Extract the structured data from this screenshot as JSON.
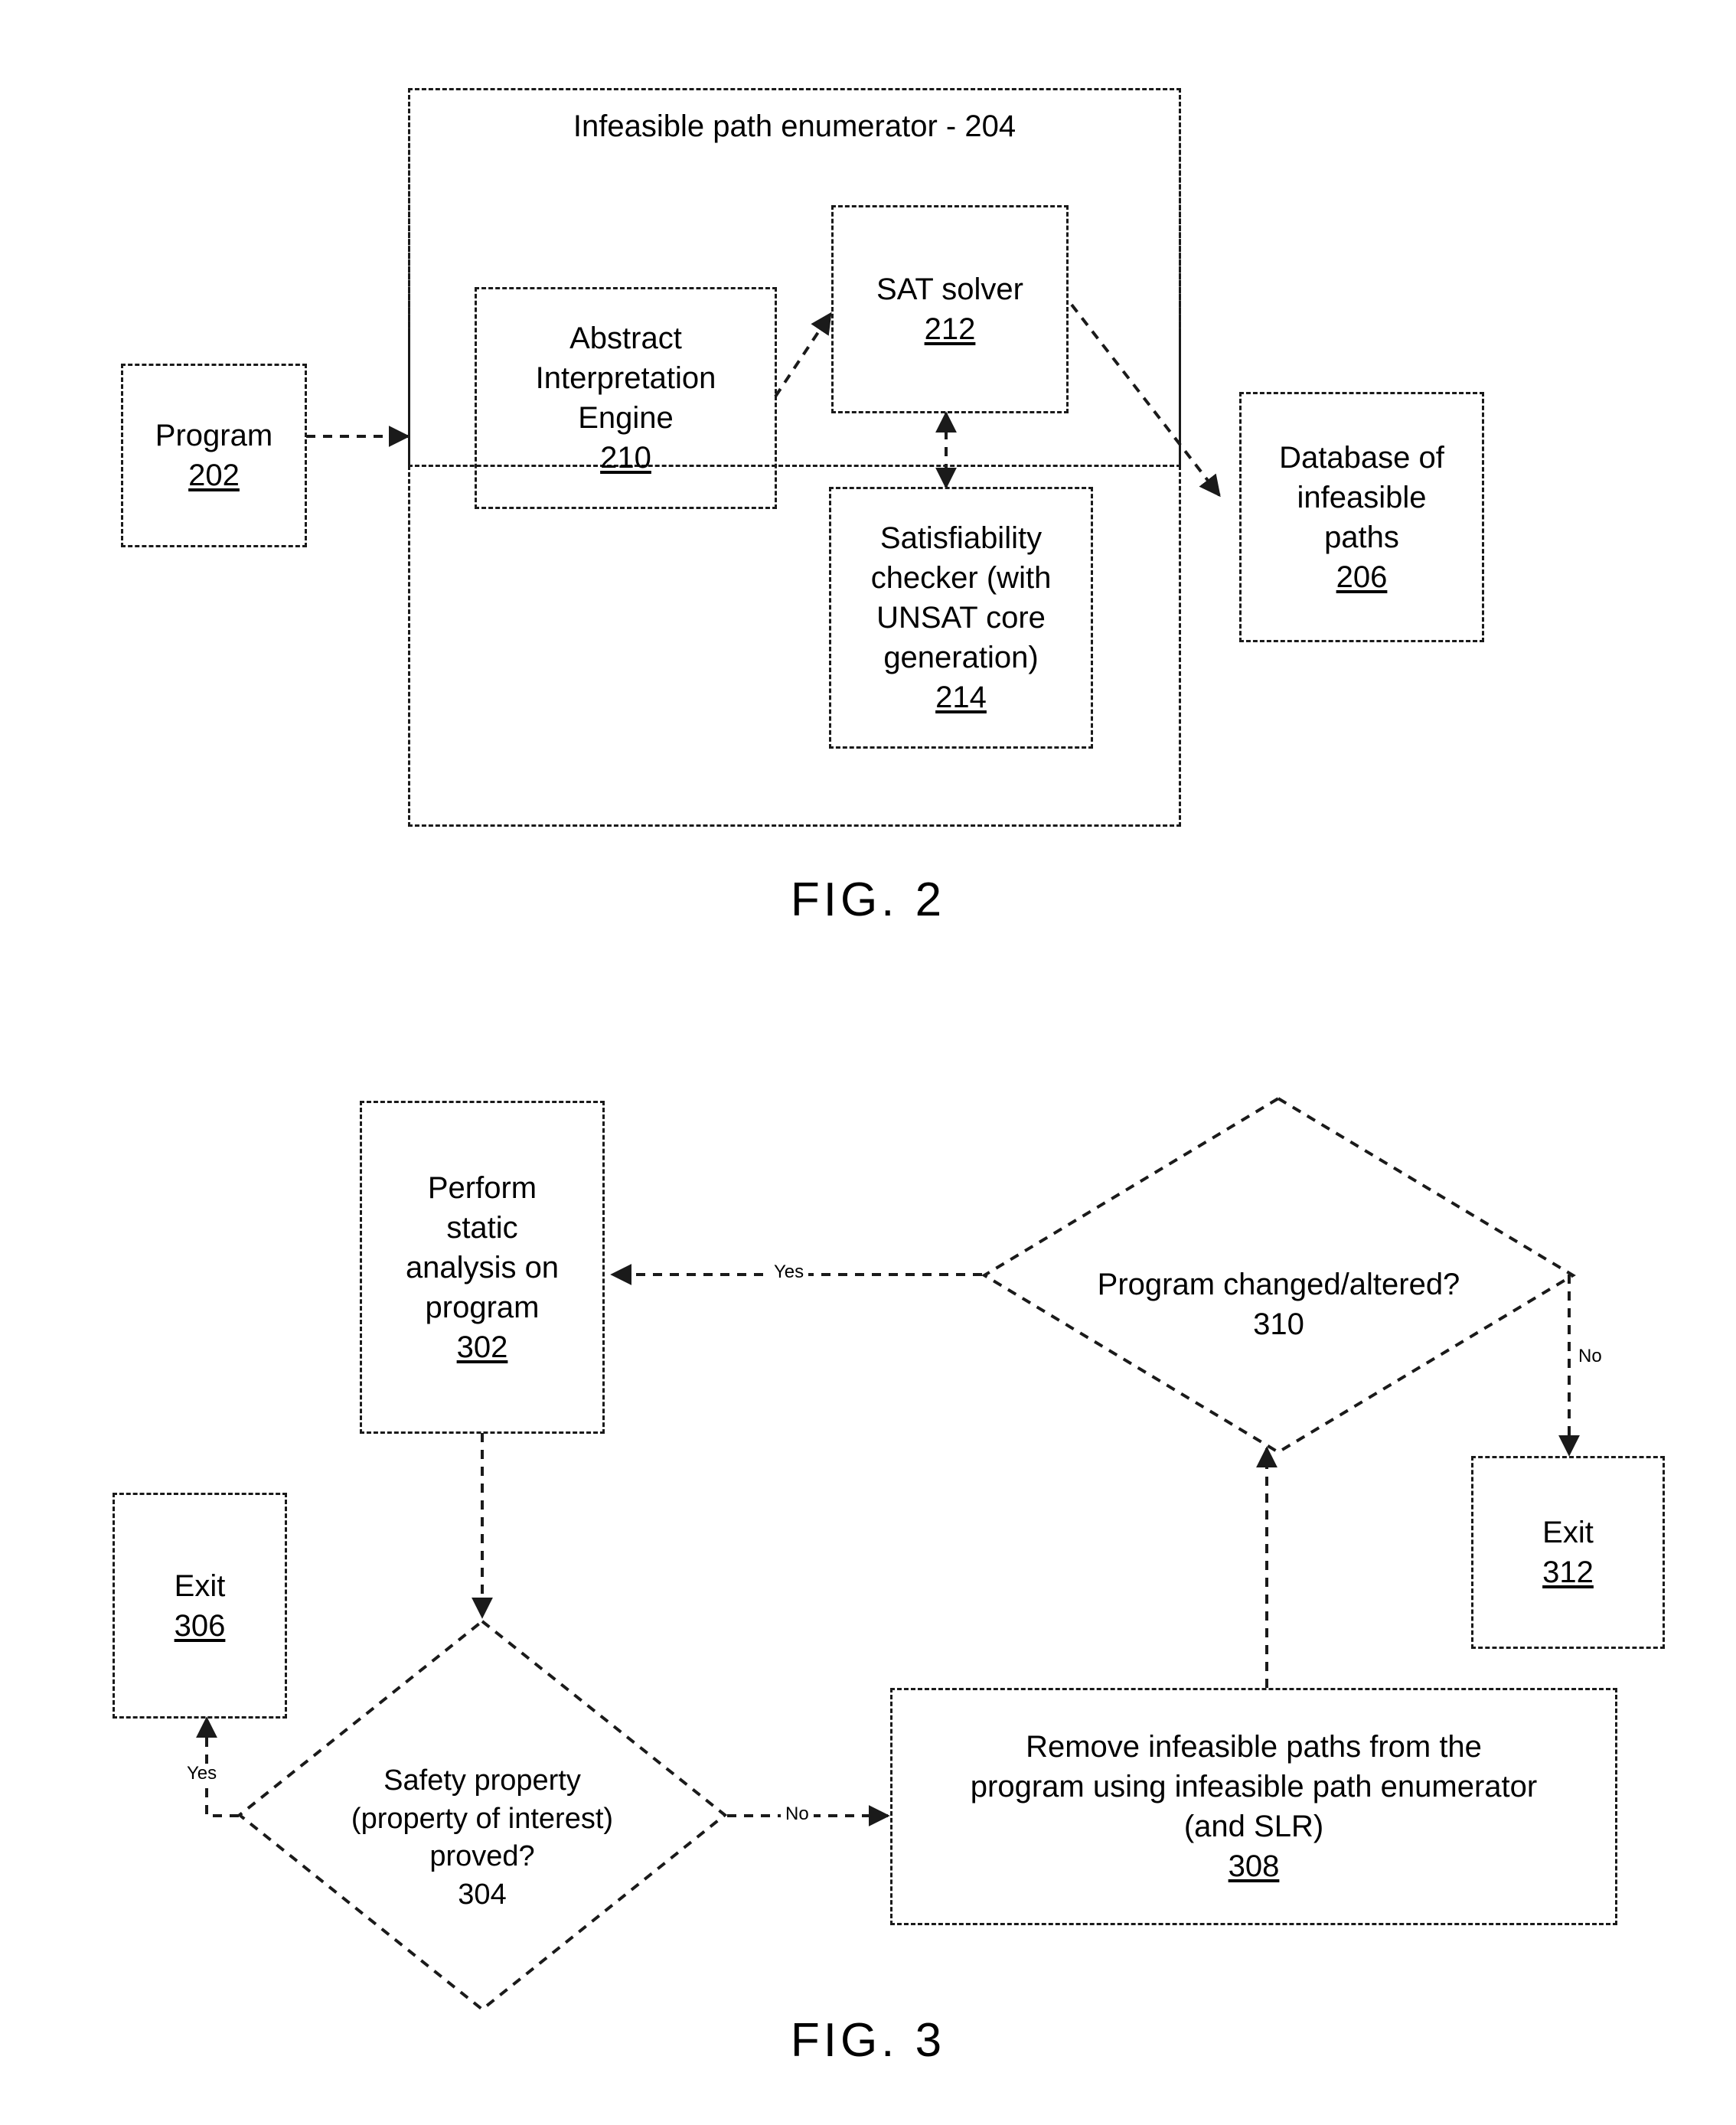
{
  "fig2": {
    "figure_label": "FIG. 2",
    "container": {
      "title": "Infeasible path enumerator - 204"
    },
    "nodes": {
      "program": {
        "label": "Program",
        "ref": "202"
      },
      "abstract_engine": {
        "label": "Abstract\nInterpretation\nEngine",
        "ref": "210"
      },
      "sat_solver": {
        "label": "SAT solver",
        "ref": "212"
      },
      "sat_checker": {
        "label": "Satisfiability\nchecker (with\nUNSAT core\ngeneration)",
        "ref": "214"
      },
      "database": {
        "label": "Database of\ninfeasible\npaths",
        "ref": "206"
      }
    }
  },
  "fig3": {
    "figure_label": "FIG. 3",
    "nodes": {
      "perform_static_analysis": {
        "label": "Perform\nstatic\nanalysis on\nprogram",
        "ref": "302"
      },
      "safety_property": {
        "label": "Safety property\n(property of interest)\nproved?",
        "ref": "304"
      },
      "exit_306": {
        "label": "Exit",
        "ref": "306"
      },
      "remove_paths": {
        "label": "Remove infeasible paths from the\nprogram using infeasible path enumerator\n(and SLR)",
        "ref": "308"
      },
      "program_changed": {
        "label": "Program changed/altered?",
        "ref": "310"
      },
      "exit_312": {
        "label": "Exit",
        "ref": "312"
      }
    },
    "edge_labels": {
      "changed_yes": "Yes",
      "changed_no": "No",
      "proved_yes": "Yes",
      "proved_no": "No"
    }
  },
  "colors": {
    "ink": "#1a1a1a",
    "background": "#ffffff"
  }
}
